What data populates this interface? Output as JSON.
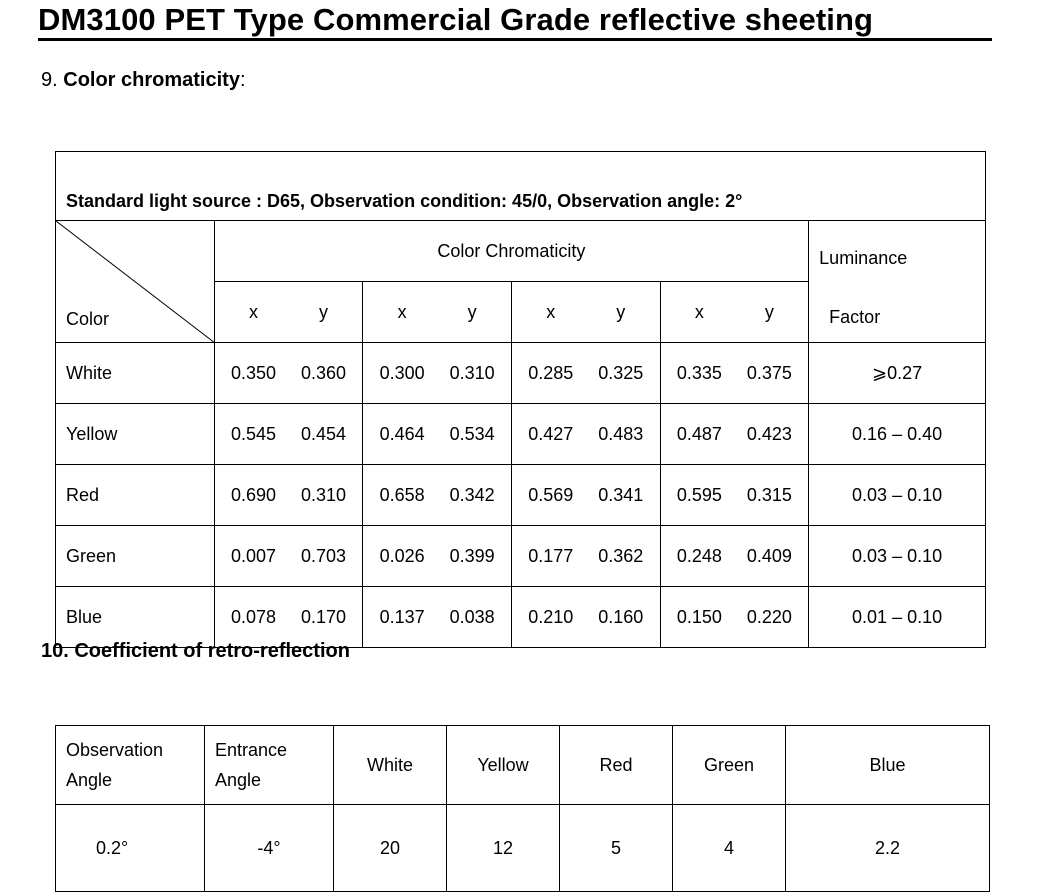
{
  "document": {
    "title": "DM3100 PET Type Commercial Grade reflective sheeting",
    "section9": {
      "number": "9.",
      "heading": "Color chromaticity",
      "suffix": ":"
    },
    "section10": {
      "heading": "10. Coefficient of retro-reflection"
    }
  },
  "chromaticity_table": {
    "condition": "Standard light source : D65, Observation condition: 45/0, Observation angle: 2°",
    "corner_label": "Color",
    "group_header": "Color Chromaticity",
    "luminance_header_line1": "Luminance",
    "luminance_header_line2": "Factor",
    "xy_labels": [
      {
        "x": "x",
        "y": "y"
      },
      {
        "x": "x",
        "y": "y"
      },
      {
        "x": "x",
        "y": "y"
      },
      {
        "x": "x",
        "y": "y"
      }
    ],
    "rows": [
      {
        "color": "White",
        "points": [
          [
            "0.350",
            "0.360"
          ],
          [
            "0.300",
            "0.310"
          ],
          [
            "0.285",
            "0.325"
          ],
          [
            "0.335",
            "0.375"
          ]
        ],
        "luminance": "⩾0.27"
      },
      {
        "color": "Yellow",
        "points": [
          [
            "0.545",
            "0.454"
          ],
          [
            "0.464",
            "0.534"
          ],
          [
            "0.427",
            "0.483"
          ],
          [
            "0.487",
            "0.423"
          ]
        ],
        "luminance": "0.16 – 0.40"
      },
      {
        "color": "Red",
        "points": [
          [
            "0.690",
            "0.310"
          ],
          [
            "0.658",
            "0.342"
          ],
          [
            "0.569",
            "0.341"
          ],
          [
            "0.595",
            "0.315"
          ]
        ],
        "luminance": "0.03 – 0.10"
      },
      {
        "color": "Green",
        "points": [
          [
            "0.007",
            "0.703"
          ],
          [
            "0.026",
            "0.399"
          ],
          [
            "0.177",
            "0.362"
          ],
          [
            "0.248",
            "0.409"
          ]
        ],
        "luminance": "0.03 – 0.10"
      },
      {
        "color": "Blue",
        "points": [
          [
            "0.078",
            "0.170"
          ],
          [
            "0.137",
            "0.038"
          ],
          [
            "0.210",
            "0.160"
          ],
          [
            "0.150",
            "0.220"
          ]
        ],
        "luminance": "0.01 – 0.10"
      }
    ]
  },
  "retro_table": {
    "headers": {
      "observation_angle": [
        "Observation",
        "Angle"
      ],
      "entrance_angle": [
        "Entrance",
        "Angle"
      ],
      "colors": [
        "White",
        "Yellow",
        "Red",
        "Green",
        "Blue"
      ]
    },
    "rows": [
      {
        "observation_angle": "0.2°",
        "entrance_angle": "-4°",
        "values": [
          "20",
          "12",
          "5",
          "4",
          "2.2"
        ]
      }
    ]
  }
}
